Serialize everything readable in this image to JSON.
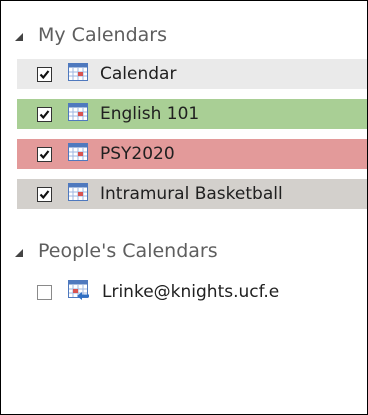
{
  "my_calendars": {
    "header": "My Calendars",
    "items": [
      {
        "label": "Calendar",
        "checked": true,
        "bg": "#eaeaea",
        "icon": "calendar-icon"
      },
      {
        "label": "English 101",
        "checked": true,
        "bg": "#a9cf95",
        "icon": "calendar-icon"
      },
      {
        "label": "PSY2020",
        "checked": true,
        "bg": "#e39a9a",
        "icon": "calendar-icon"
      },
      {
        "label": "Intramural Basketball",
        "checked": true,
        "bg": "#d3d0cc",
        "icon": "calendar-icon"
      }
    ]
  },
  "people_calendars": {
    "header": "People's Calendars",
    "items": [
      {
        "label": "Lrinke@knights.ucf.e",
        "checked": false,
        "bg": "#ffffff",
        "icon": "shared-calendar-icon"
      }
    ]
  }
}
